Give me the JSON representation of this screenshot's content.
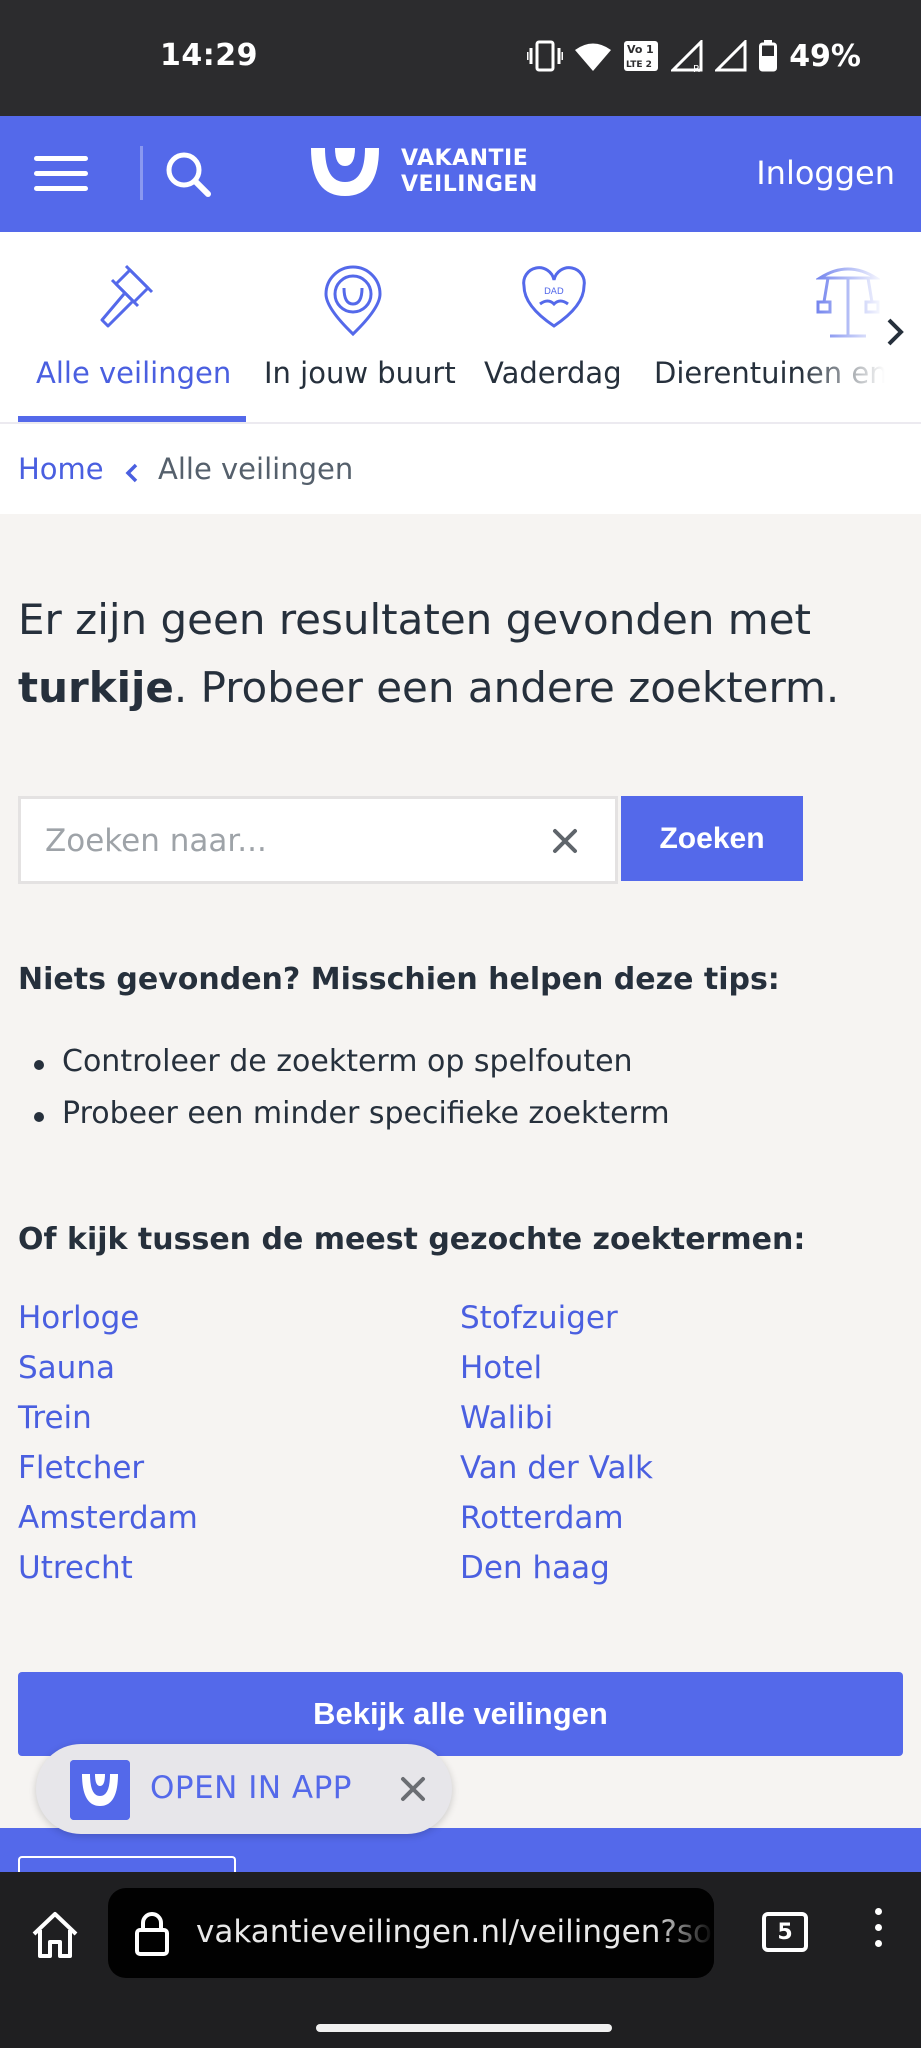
{
  "status_bar": {
    "time": "14:29",
    "battery": "49%",
    "icons": [
      "vibrate-icon",
      "wifi-icon",
      "volte-icon",
      "signal-icon",
      "signal-icon",
      "battery-icon"
    ],
    "volte_line1": "Vo",
    "volte_line2": "LTE 2",
    "volte_num": "1",
    "roaming_label": "R"
  },
  "header": {
    "logo_line1": "VAKANTIE",
    "logo_line2": "VEILINGEN",
    "login_label": "Inloggen"
  },
  "categories": [
    {
      "label": "Alle veilingen",
      "icon": "gavel-icon",
      "active": true
    },
    {
      "label": "In jouw buurt",
      "icon": "location-pin-icon",
      "active": false
    },
    {
      "label": "Vaderdag",
      "icon": "heart-dad-icon",
      "active": false,
      "badge": "DAD"
    },
    {
      "label": "Dierentuinen en P",
      "icon": "ride-icon",
      "active": false
    }
  ],
  "breadcrumb": {
    "home": "Home",
    "separator": "<",
    "current": "Alle veilingen"
  },
  "no_results": {
    "prefix": "Er zijn geen resultaten gevonden met ",
    "term": "turkije",
    "suffix": ". Probeer een andere zoekterm."
  },
  "search": {
    "placeholder": "Zoeken naar...",
    "value": "",
    "button_label": "Zoeken"
  },
  "tips": {
    "title": "Niets gevonden? Misschien helpen deze tips:",
    "items": [
      "Controleer de zoekterm op spelfouten",
      "Probeer een minder specifieke zoekterm"
    ]
  },
  "popular_terms": {
    "title": "Of kijk tussen de meest gezochte zoektermen:",
    "left": [
      "Horloge",
      "Sauna",
      "Trein",
      "Fletcher",
      "Amsterdam",
      "Utrecht"
    ],
    "right": [
      "Stofzuiger",
      "Hotel",
      "Walibi",
      "Van der Valk",
      "Rotterdam",
      "Den haag"
    ]
  },
  "all_auctions_button": "Bekijk alle veilingen",
  "app_banner": {
    "label": "OPEN IN APP"
  },
  "browser": {
    "url": "vakantieveilingen.nl/veilingen?sort",
    "tab_count": "5"
  },
  "colors": {
    "brand": "#5469ea",
    "link": "#4a5fe0",
    "text": "#26303c",
    "page_bg": "#f6f4f2"
  }
}
